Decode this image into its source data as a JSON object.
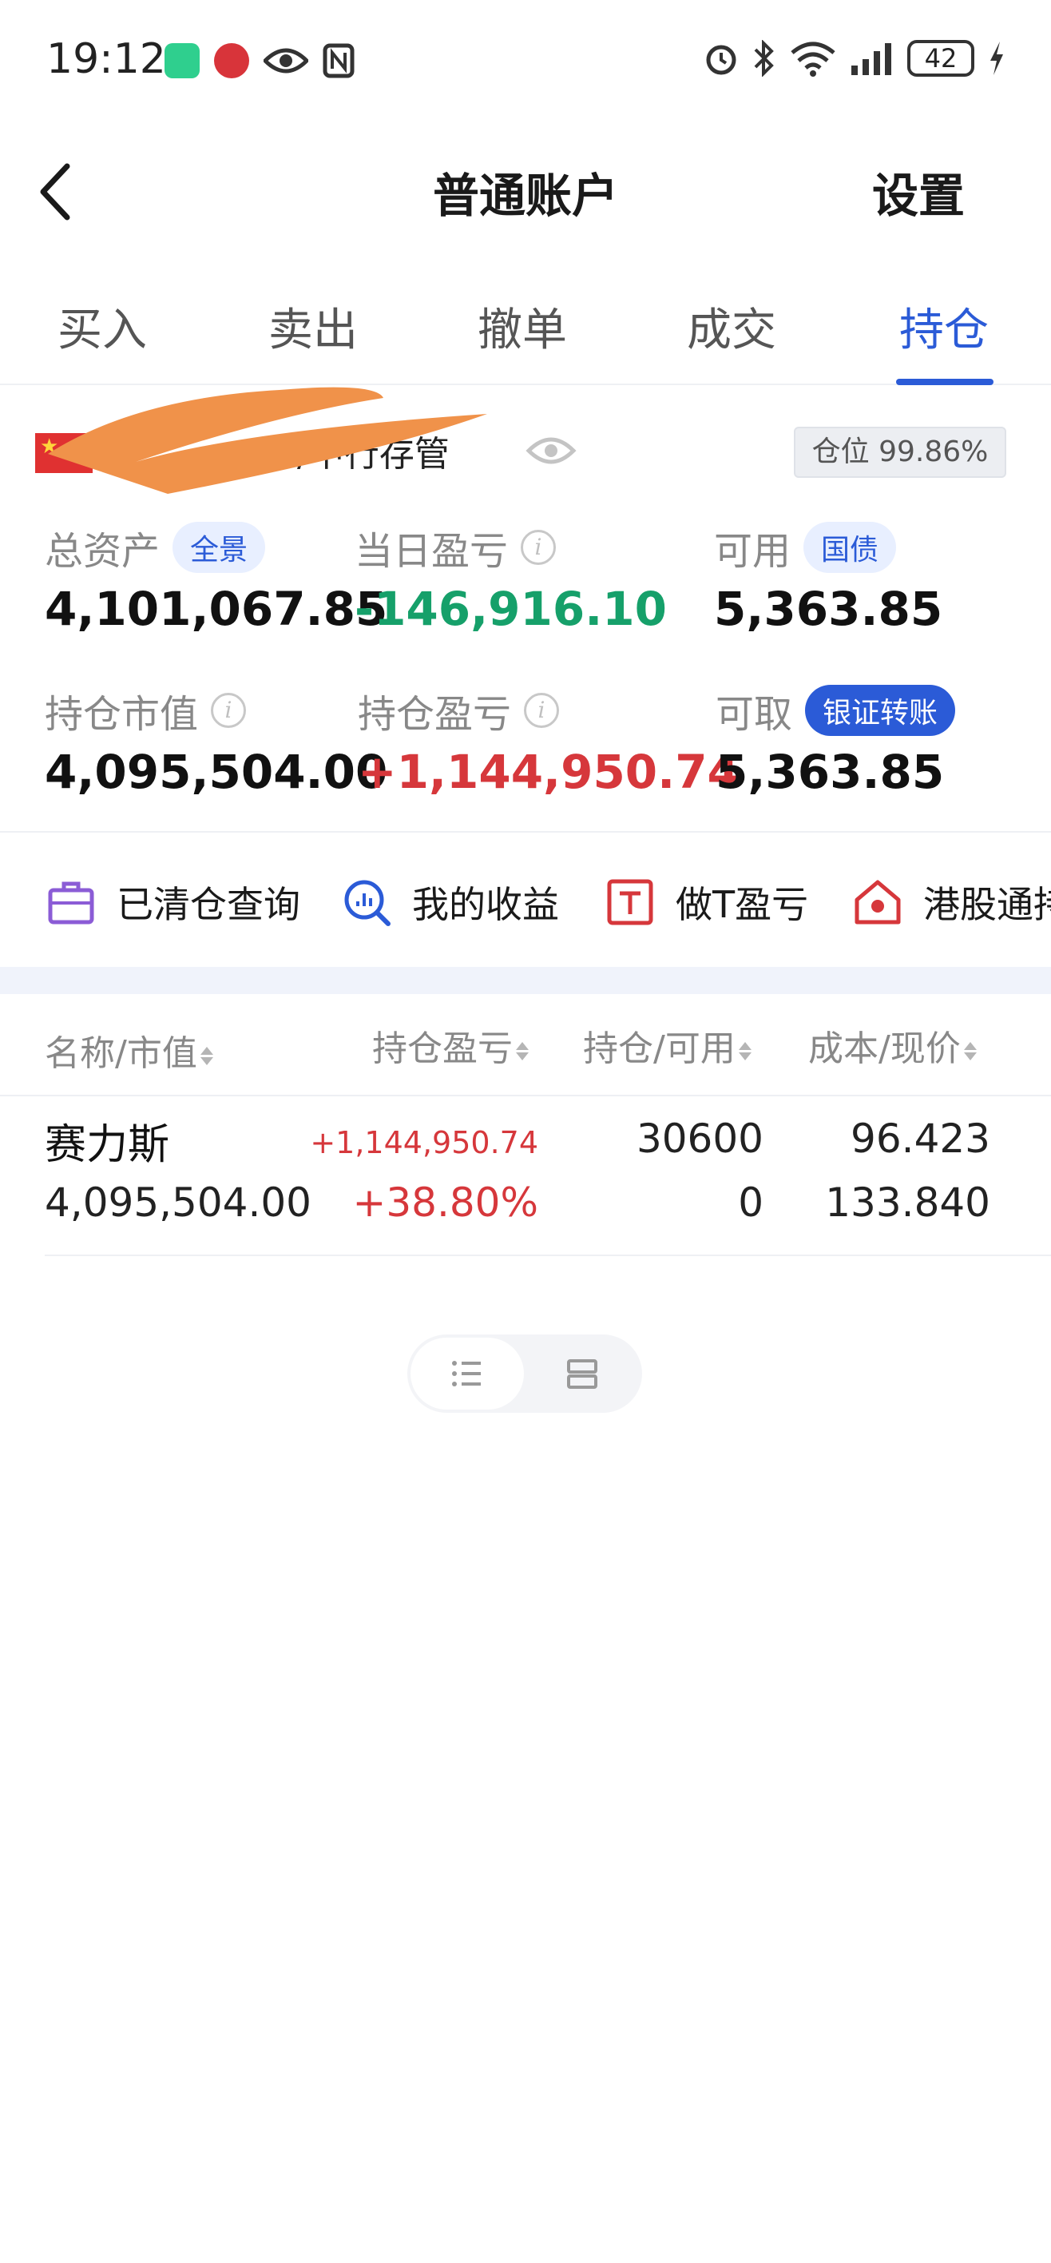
{
  "status_bar": {
    "time": "19:12",
    "battery": "42"
  },
  "header": {
    "title": "普通账户",
    "settings": "设置"
  },
  "tabs": [
    {
      "label": "买入"
    },
    {
      "label": "卖出"
    },
    {
      "label": "撤单"
    },
    {
      "label": "成交"
    },
    {
      "label": "持仓"
    }
  ],
  "active_tab": "持仓",
  "account": {
    "name_visible": "/中行存管",
    "position_ratio": "仓位 99.86%"
  },
  "metrics": {
    "total_assets": {
      "label": "总资产",
      "chip": "全景",
      "value": "4,101,067.85"
    },
    "daily_pl": {
      "label": "当日盈亏",
      "value": "-146,916.10"
    },
    "available": {
      "label": "可用",
      "chip": "国债",
      "value": "5,363.85"
    },
    "market_value": {
      "label": "持仓市值",
      "value": "4,095,504.00"
    },
    "position_pl": {
      "label": "持仓盈亏",
      "value": "+1,144,950.74"
    },
    "withdrawable": {
      "label": "可取",
      "chip": "银证转账",
      "value": "5,363.85"
    }
  },
  "quick_actions": [
    {
      "label": "已清仓查询"
    },
    {
      "label": "我的收益"
    },
    {
      "label": "做T盈亏"
    },
    {
      "label": "港股通持"
    }
  ],
  "table": {
    "headers": [
      "名称/市值",
      "持仓盈亏",
      "持仓/可用",
      "成本/现价"
    ],
    "rows": [
      {
        "name": "赛力斯",
        "market_value": "4,095,504.00",
        "pl": "+1,144,950.74",
        "pl_pct": "+38.80%",
        "holding": "30600",
        "available": "0",
        "cost": "96.423",
        "price": "133.840"
      }
    ]
  },
  "colors": {
    "accent": "#2b5bd7",
    "gain": "#d6373b",
    "loss": "#16a06a"
  }
}
